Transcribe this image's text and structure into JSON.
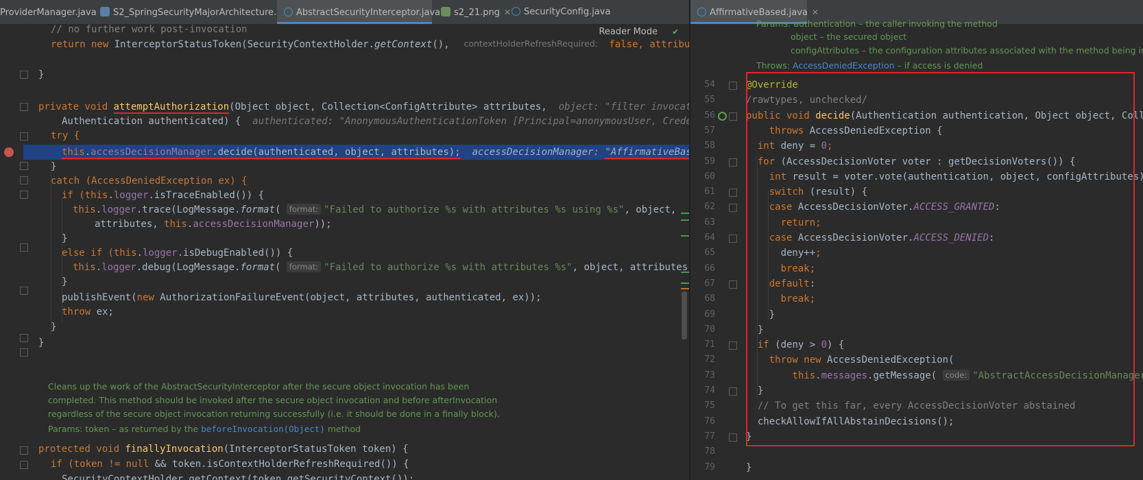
{
  "left_tabs": [
    {
      "label": "ProviderManager.java",
      "icon": "java-file-icon",
      "active": false
    },
    {
      "label": "S2_SpringSecurityMajorArchitecture.md",
      "icon": "markdown-file-icon",
      "active": false
    },
    {
      "label": "AbstractSecurityInterceptor.java",
      "icon": "java-file-icon",
      "active": true
    },
    {
      "label": "s2_21.png",
      "icon": "image-file-icon",
      "active": false
    },
    {
      "label": "SecurityConfig.java",
      "icon": "java-file-icon",
      "active": false
    }
  ],
  "right_tabs": [
    {
      "label": "AffirmativeBased.java",
      "icon": "java-file-icon",
      "active": true
    }
  ],
  "reader_mode": "Reader Mode",
  "left_code": {
    "l1": "// no further work post-invocation",
    "l2_a": "return new ",
    "l2_b": "InterceptorStatusToken(SecurityContextHolder.",
    "l2_c": "getContext",
    "l2_d": "(),",
    "l2_hint": "contextHolderRefreshRequired:",
    "l2_e": " false",
    "l2_f": ", attributes, obj",
    "l3": "}",
    "l4_a": "private void ",
    "l4_b": "attemptAuthorization",
    "l4_c": "(Object object, Collection<ConfigAttribute> attributes,",
    "l4_hint": "object: \"filter invocation",
    "l5_a": "Authentication authenticated) {",
    "l5_hint": "authenticated: \"AnonymousAuthenticationToken [Principal=anonymousUser, Credenti",
    "l6": "try {",
    "l7_a": "this",
    "l7_b": ".",
    "l7_c": "accessDecisionManager",
    "l7_d": ".decide(authenticated, object, attributes);",
    "l7_hint_a": "accessDecisionManager: ",
    "l7_hint_b": "\"AffirmativeBased",
    "l8": "}",
    "l9": "catch (AccessDeniedException ex) {",
    "l10_a": "if (",
    "l10_b": "this",
    "l10_c": ".",
    "l10_d": "logger",
    "l10_e": ".isTraceEnabled()) {",
    "l11_a": "this",
    "l11_b": ".",
    "l11_c": "logger",
    "l11_d": ".trace(LogMessage.",
    "l11_e": "format",
    "l11_f": "(",
    "l11_tag": "format:",
    "l11_str": "\"Failed to authorize %s with attributes %s using %s\"",
    "l11_g": ", object,",
    "l12_a": "attributes, ",
    "l12_b": "this",
    "l12_c": ".",
    "l12_d": "accessDecisionManager",
    "l12_e": "));",
    "l13": "}",
    "l14_a": "else if (",
    "l14_b": "this",
    "l14_c": ".",
    "l14_d": "logger",
    "l14_e": ".isDebugEnabled()) {",
    "l15_a": "this",
    "l15_b": ".",
    "l15_c": "logger",
    "l15_d": ".debug(LogMessage.",
    "l15_e": "format",
    "l15_f": "(",
    "l15_tag": "format:",
    "l15_str": "\"Failed to authorize %s with attributes %s\"",
    "l15_g": ", object, attributes));",
    "l16": "}",
    "l17_a": "publishEvent(",
    "l17_b": "new ",
    "l17_c": "AuthorizationFailureEvent(object, attributes, authenticated, ex));",
    "l18_a": "throw ",
    "l18_b": "ex;",
    "l19": "}",
    "l20": "}",
    "doc1": "Cleans up the work of the AbstractSecurityInterceptor after the secure object invocation has been",
    "doc2": "completed. This method should be invoked after the secure object invocation and before afterInvocation",
    "doc3": "regardless of the secure object invocation returning successfully (i.e. it should be done in a finally block).",
    "doc4_a": "Params: token – as returned by the ",
    "doc4_b": "beforeInvocation(Object)",
    "doc4_c": " method",
    "l21_a": "protected void ",
    "l21_b": "finallyInvocation",
    "l21_c": "(InterceptorStatusToken token) {",
    "l22_a": "if (token != ",
    "l22_b": "null ",
    "l22_c": "&& token.isContextHolderRefreshRequired()) {",
    "l23": "SecurityContextHolder.getContext(token.getSecurityContext());"
  },
  "right_doc": {
    "p1": "Params: authentication – the caller invoking the method",
    "p2": "object – the secured object",
    "p3": "configAttributes – the configuration attributes associated with the method being invok",
    "t_a": "Throws: ",
    "t_b": "AccessDeniedException",
    "t_c": " – if access is denied"
  },
  "right_code": [
    {
      "n": "54",
      "parts": [
        {
          "c": "ann",
          "t": "@Override"
        }
      ]
    },
    {
      "n": "55",
      "parts": [
        {
          "c": "cmt",
          "t": "/rawtypes, unchecked/"
        }
      ]
    },
    {
      "n": "56",
      "parts": [
        {
          "c": "kw",
          "t": "public void "
        },
        {
          "c": "fn",
          "t": "decide"
        },
        {
          "c": "",
          "t": "(Authentication authentication, Object object, Collec"
        }
      ]
    },
    {
      "n": "57",
      "parts": [
        {
          "c": "kw",
          "t": "    throws "
        },
        {
          "c": "",
          "t": "AccessDeniedException {"
        }
      ]
    },
    {
      "n": "58",
      "parts": [
        {
          "c": "kw",
          "t": "  int "
        },
        {
          "c": "",
          "t": "deny = "
        },
        {
          "c": "fld",
          "t": "0"
        },
        {
          "c": "kw",
          "t": ";"
        }
      ]
    },
    {
      "n": "59",
      "parts": [
        {
          "c": "kw",
          "t": "  for "
        },
        {
          "c": "",
          "t": "(AccessDecisionVoter voter : getDecisionVoters()) {"
        }
      ]
    },
    {
      "n": "60",
      "parts": [
        {
          "c": "kw",
          "t": "    int "
        },
        {
          "c": "",
          "t": "result = voter.vote(authentication, object, configAttributes);"
        }
      ]
    },
    {
      "n": "61",
      "parts": [
        {
          "c": "kw",
          "t": "    switch "
        },
        {
          "c": "",
          "t": "(result) {"
        }
      ]
    },
    {
      "n": "62",
      "parts": [
        {
          "c": "kw",
          "t": "    case "
        },
        {
          "c": "",
          "t": "AccessDecisionVoter."
        },
        {
          "c": "fld-ital",
          "t": "ACCESS_GRANTED"
        },
        {
          "c": "",
          "t": ":"
        }
      ]
    },
    {
      "n": "63",
      "parts": [
        {
          "c": "kw",
          "t": "      return;"
        }
      ]
    },
    {
      "n": "64",
      "parts": [
        {
          "c": "kw",
          "t": "    case "
        },
        {
          "c": "",
          "t": "AccessDecisionVoter."
        },
        {
          "c": "fld-ital",
          "t": "ACCESS_DENIED"
        },
        {
          "c": "",
          "t": ":"
        }
      ]
    },
    {
      "n": "65",
      "parts": [
        {
          "c": "",
          "t": "      deny++"
        },
        {
          "c": "kw",
          "t": ";"
        }
      ]
    },
    {
      "n": "66",
      "parts": [
        {
          "c": "kw",
          "t": "      break;"
        }
      ]
    },
    {
      "n": "67",
      "parts": [
        {
          "c": "kw",
          "t": "    default"
        },
        {
          "c": "",
          "t": ":"
        }
      ]
    },
    {
      "n": "68",
      "parts": [
        {
          "c": "kw",
          "t": "      break;"
        }
      ]
    },
    {
      "n": "69",
      "parts": [
        {
          "c": "",
          "t": "    }"
        }
      ]
    },
    {
      "n": "70",
      "parts": [
        {
          "c": "",
          "t": "  }"
        }
      ]
    },
    {
      "n": "71",
      "parts": [
        {
          "c": "kw",
          "t": "  if "
        },
        {
          "c": "",
          "t": "(deny > "
        },
        {
          "c": "fld",
          "t": "0"
        },
        {
          "c": "",
          "t": ") {"
        }
      ]
    },
    {
      "n": "72",
      "parts": [
        {
          "c": "kw",
          "t": "    throw new "
        },
        {
          "c": "",
          "t": "AccessDeniedException("
        }
      ]
    },
    {
      "n": "73",
      "parts": [
        {
          "c": "kw",
          "t": "        this"
        },
        {
          "c": "",
          "t": "."
        },
        {
          "c": "fld",
          "t": "messages"
        },
        {
          "c": "",
          "t": ".getMessage( "
        },
        {
          "c": "tag",
          "t": "code:"
        },
        {
          "c": "str",
          "t": "\"AbstractAccessDecisionManager.ac"
        }
      ]
    },
    {
      "n": "74",
      "parts": [
        {
          "c": "",
          "t": "  }"
        }
      ]
    },
    {
      "n": "75",
      "parts": [
        {
          "c": "cmt",
          "t": "  // To get this far, every AccessDecisionVoter abstained"
        }
      ]
    },
    {
      "n": "76",
      "parts": [
        {
          "c": "",
          "t": "  checkAllowIfAllAbstainDecisions();"
        }
      ]
    },
    {
      "n": "77",
      "parts": [
        {
          "c": "",
          "t": "}"
        }
      ]
    },
    {
      "n": "78",
      "parts": []
    },
    {
      "n": "79",
      "parts": [
        {
          "c": "",
          "t": "}"
        }
      ]
    }
  ]
}
